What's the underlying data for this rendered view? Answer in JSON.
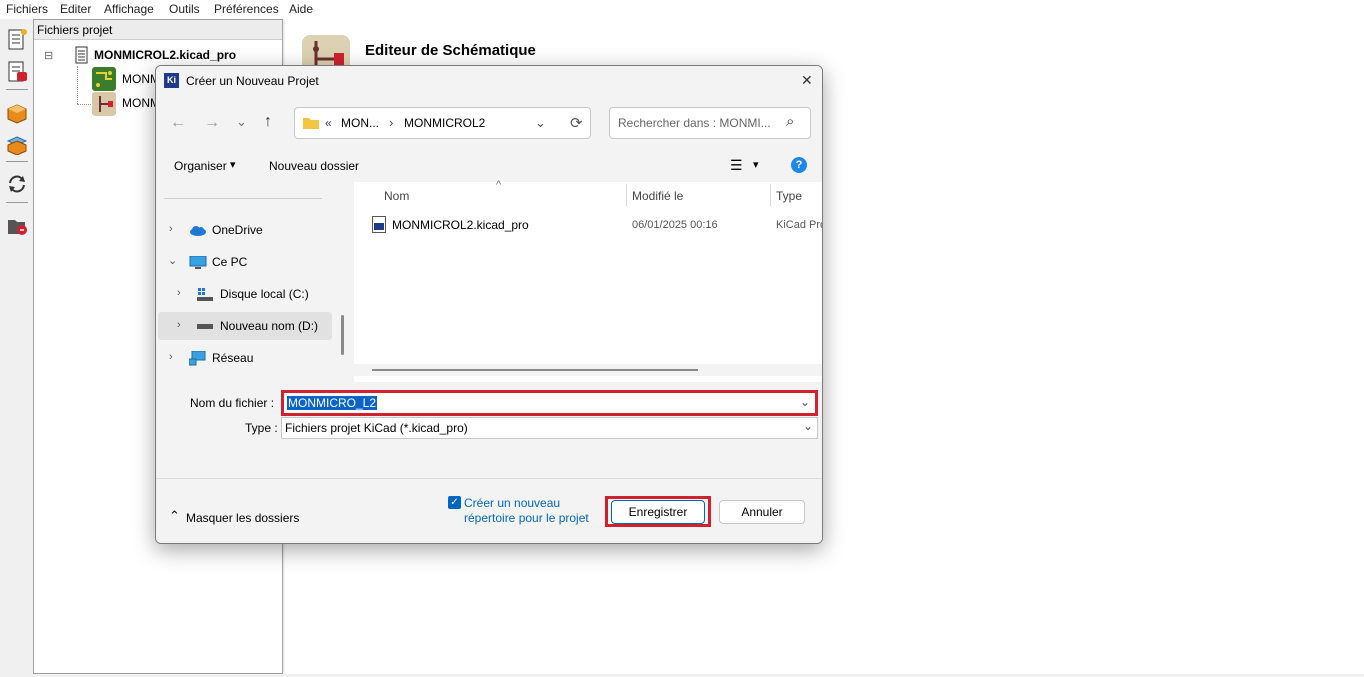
{
  "menubar": {
    "items": [
      "Fichiers",
      "Editer",
      "Affichage",
      "Outils",
      "Préférences",
      "Aide"
    ]
  },
  "project_panel": {
    "header": "Fichiers projet",
    "root_label": "MONMICROL2.kicad_pro",
    "child1_label": "MONM",
    "child2_label": "MONM",
    "collapse_sign": "⊟"
  },
  "main": {
    "schematic_editor_title": "Editeur de Schématique"
  },
  "dialog": {
    "app_badge": "Ki",
    "title": "Créer un Nouveau Projet",
    "close_glyph": "✕",
    "nav": {
      "back": "←",
      "forward": "→",
      "recent": "⌄",
      "up": "↑",
      "path_prefix": "«",
      "path_part1": "MON...",
      "path_sep": "›",
      "path_part2": "MONMICROL2",
      "path_dropdown": "⌄",
      "refresh": "⟳",
      "search_placeholder": "Rechercher dans : MONMI...",
      "search_icon": "⌕"
    },
    "commands": {
      "organize": "Organiser",
      "organize_arrow": "▾",
      "new_folder": "Nouveau dossier",
      "view_icon": "☰",
      "view_arrow": "▾",
      "help": "?"
    },
    "sidebar": {
      "items": [
        {
          "label": "OneDrive",
          "chevron": "›"
        },
        {
          "label": "Ce PC",
          "chevron": "⌄"
        },
        {
          "label": "Disque local (C:)",
          "chevron": "›"
        },
        {
          "label": "Nouveau nom (D:)",
          "chevron": "›"
        },
        {
          "label": "Réseau",
          "chevron": "›"
        }
      ]
    },
    "file_list": {
      "sort_indicator": "^",
      "columns": [
        "Nom",
        "Modifié le",
        "Type"
      ],
      "rows": [
        {
          "name": "MONMICROL2.kicad_pro",
          "modified": "06/01/2025 00:16",
          "type": "KiCad Pro"
        }
      ]
    },
    "filename": {
      "label": "Nom du fichier :",
      "value": "MONMICRO_L2",
      "dropdown": "⌄"
    },
    "filetype": {
      "label": "Type :",
      "value": "Fichiers projet KiCad (*.kicad_pro)",
      "dropdown": "⌄"
    },
    "footer": {
      "hide_folders_icon": "⌃",
      "hide_folders": "Masquer les dossiers",
      "checkbox_mark": "✓",
      "checkbox_line1": "Créer un nouveau",
      "checkbox_line2": "répertoire pour le projet",
      "save": "Enregistrer",
      "cancel": "Annuler"
    }
  },
  "colors": {
    "highlight_red": "#d0212e",
    "annotation_blue": "#1aa0d8",
    "accent": "#0067c0",
    "selection": "#0a64c8"
  }
}
